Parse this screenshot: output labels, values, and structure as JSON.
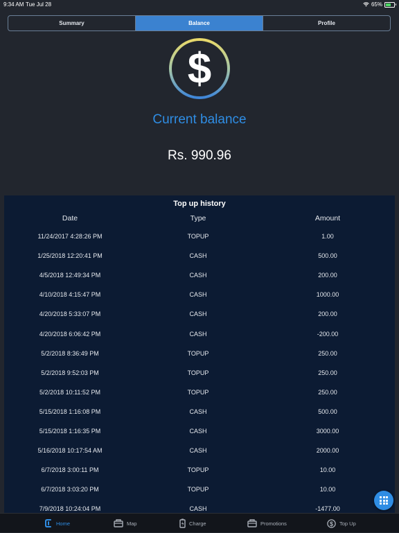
{
  "status_bar": {
    "time": "9:34 AM",
    "date": "Tue Jul 28",
    "battery": "65%"
  },
  "segments": [
    {
      "label": "Summary",
      "active": false
    },
    {
      "label": "Balance",
      "active": true
    },
    {
      "label": "Profile",
      "active": false
    }
  ],
  "balance": {
    "label": "Current balance",
    "value": "Rs. 990.96"
  },
  "history": {
    "title": "Top up history",
    "columns": {
      "date": "Date",
      "type": "Type",
      "amount": "Amount"
    },
    "rows": [
      {
        "date": "11/24/2017 4:28:26 PM",
        "type": "TOPUP",
        "amount": "1.00"
      },
      {
        "date": "1/25/2018 12:20:41 PM",
        "type": "CASH",
        "amount": "500.00"
      },
      {
        "date": "4/5/2018 12:49:34 PM",
        "type": "CASH",
        "amount": "200.00"
      },
      {
        "date": "4/10/2018 4:15:47 PM",
        "type": "CASH",
        "amount": "1000.00"
      },
      {
        "date": "4/20/2018 5:33:07 PM",
        "type": "CASH",
        "amount": "200.00"
      },
      {
        "date": "4/20/2018 6:06:42 PM",
        "type": "CASH",
        "amount": "-200.00"
      },
      {
        "date": "5/2/2018 8:36:49 PM",
        "type": "TOPUP",
        "amount": "250.00"
      },
      {
        "date": "5/2/2018 9:52:03 PM",
        "type": "TOPUP",
        "amount": "250.00"
      },
      {
        "date": "5/2/2018 10:11:52 PM",
        "type": "TOPUP",
        "amount": "250.00"
      },
      {
        "date": "5/15/2018 1:16:08 PM",
        "type": "CASH",
        "amount": "500.00"
      },
      {
        "date": "5/15/2018 1:16:35 PM",
        "type": "CASH",
        "amount": "3000.00"
      },
      {
        "date": "5/16/2018 10:17:54 AM",
        "type": "CASH",
        "amount": "2000.00"
      },
      {
        "date": "6/7/2018 3:00:11 PM",
        "type": "TOPUP",
        "amount": "10.00"
      },
      {
        "date": "6/7/2018 3:03:20 PM",
        "type": "TOPUP",
        "amount": "10.00"
      },
      {
        "date": "7/9/2018 10:24:04 PM",
        "type": "CASH",
        "amount": "-1477.00"
      }
    ]
  },
  "tabs": [
    {
      "label": "Home",
      "icon": "home-icon",
      "active": true
    },
    {
      "label": "Map",
      "icon": "map-icon",
      "active": false
    },
    {
      "label": "Charge",
      "icon": "charge-icon",
      "active": false
    },
    {
      "label": "Promotions",
      "icon": "promotions-icon",
      "active": false
    },
    {
      "label": "Top Up",
      "icon": "top-up-icon",
      "active": false
    }
  ],
  "colors": {
    "background": "#22262e",
    "accent": "#2f8de4",
    "segment_active": "#3b82d0",
    "panel": "#0c1b33",
    "tabbar": "#12151b"
  }
}
